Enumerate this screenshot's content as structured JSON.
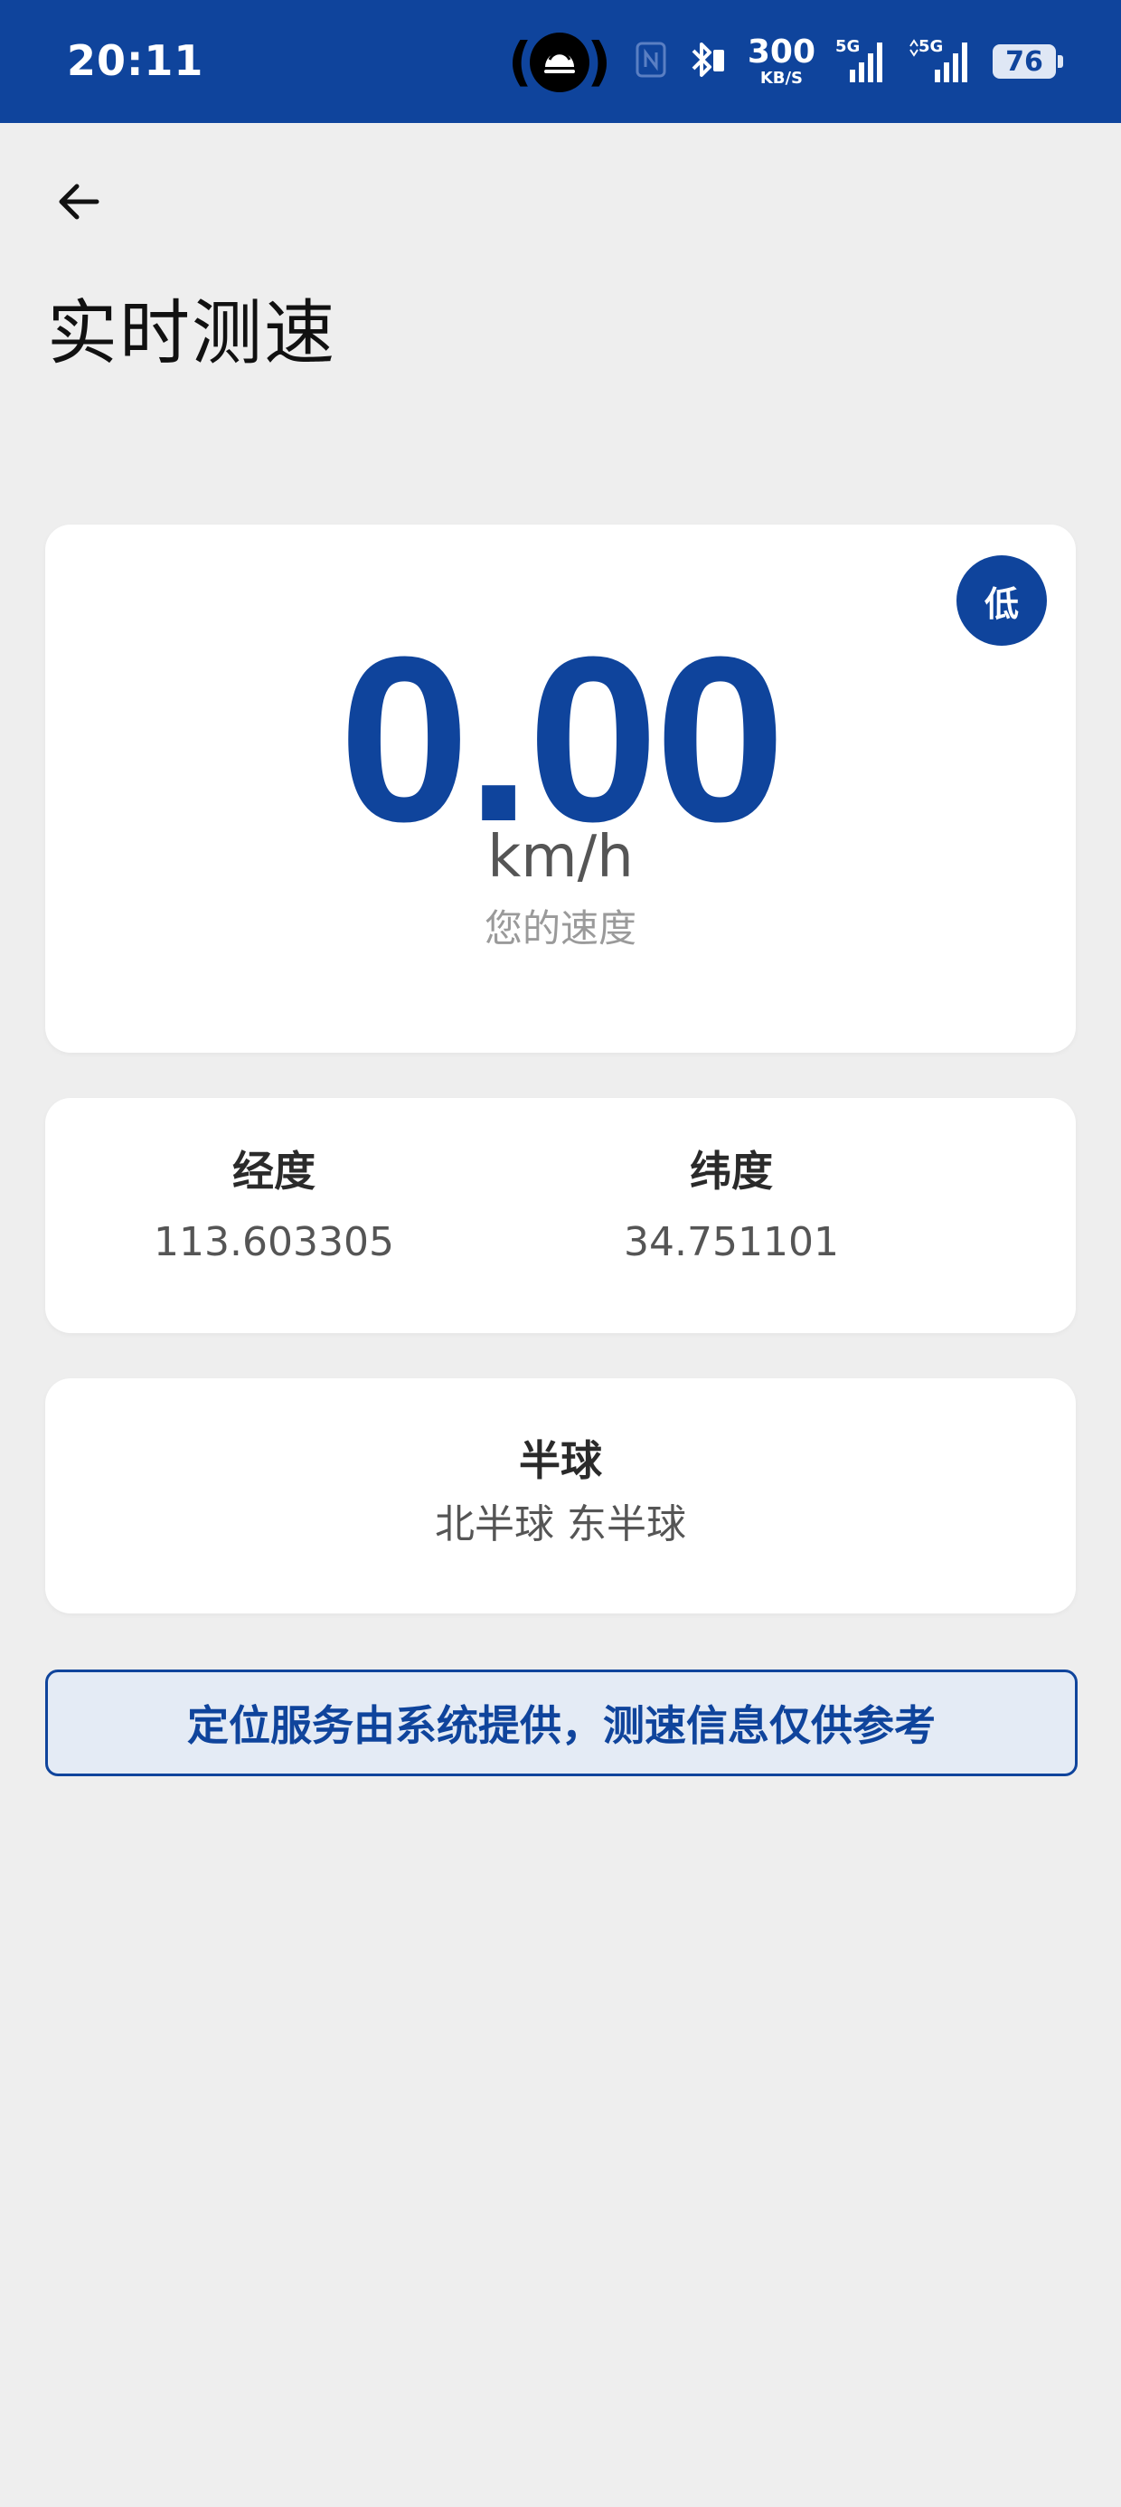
{
  "status_bar": {
    "time": "20:11",
    "net_speed_value": "300",
    "net_speed_unit": "KB/S",
    "signal_1_label": "5G",
    "signal_2_label": "5G",
    "battery_level": "76",
    "icons": [
      "hotspot-icon",
      "nfc-icon",
      "bluetooth-icon",
      "signal-5g-icon",
      "signal-5g-icon",
      "battery-icon"
    ],
    "background_color": "#0f449c"
  },
  "header": {
    "back_icon": "arrow-left-icon",
    "title": "实时测速"
  },
  "speed": {
    "value": "0.00",
    "unit": "km/h",
    "caption": "您的速度",
    "level_badge": "低",
    "accent_color": "#0f449c"
  },
  "coordinates": {
    "longitude_label": "经度",
    "longitude_value": "113.603305",
    "latitude_label": "纬度",
    "latitude_value": "34.751101"
  },
  "hemisphere": {
    "label": "半球",
    "value": "北半球 东半球"
  },
  "notice": {
    "text": "定位服务由系统提供，测速信息仅供参考"
  }
}
